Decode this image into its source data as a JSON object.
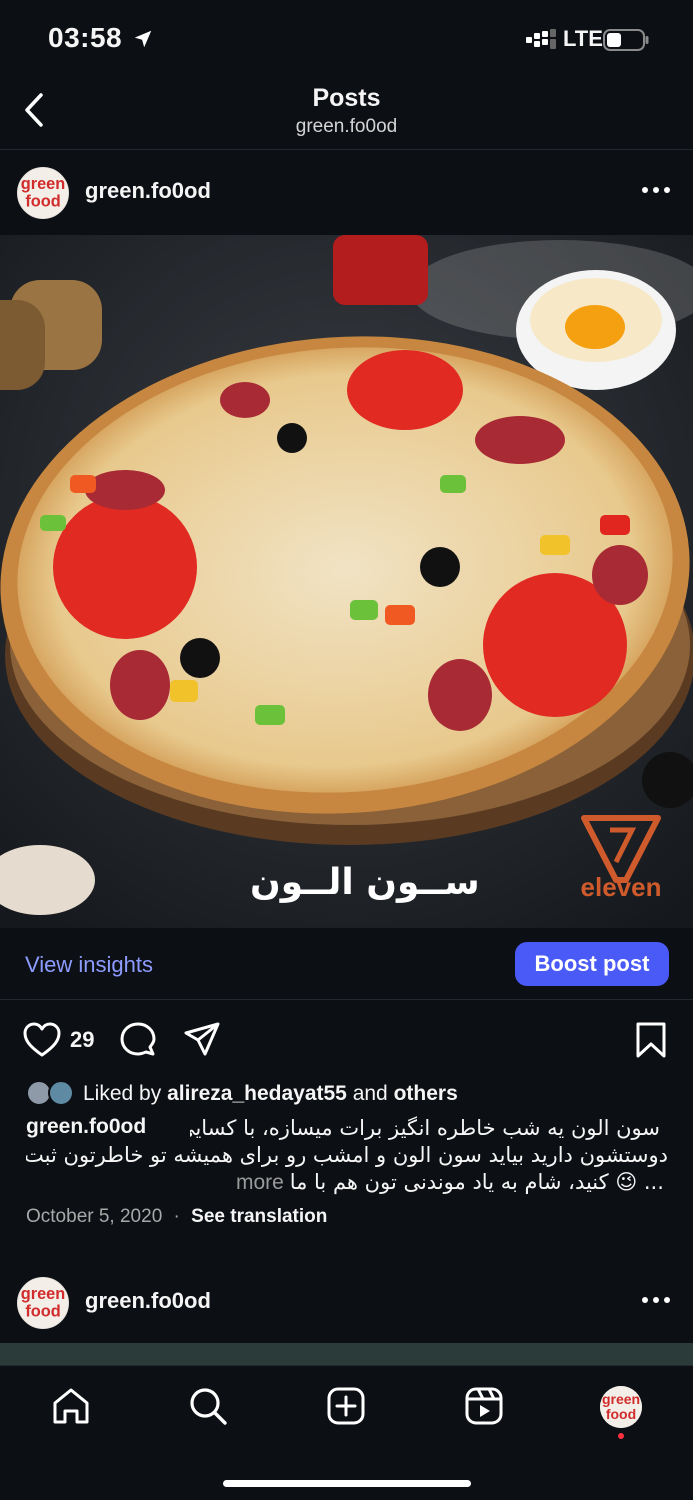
{
  "status_bar": {
    "time": "03:58",
    "network": "LTE"
  },
  "header": {
    "title": "Posts",
    "subtitle": "green.fo0od"
  },
  "post": {
    "username": "green.fo0od",
    "brand_text_persian": "ســون الــون",
    "logo_text": "eleven",
    "insights_label": "View insights",
    "boost_label": "Boost post",
    "like_count": "29",
    "likes": {
      "prefix": "Liked by",
      "user": "alireza_hedayat55",
      "connector": "and",
      "others": "others"
    },
    "caption": {
      "username": "green.fo0od",
      "line1": "سون الون یه شب خاطره انگیز برات میسازه، با کسایی که",
      "line2": "دوستشون دارید بیاید سون الون و امشب رو برای همیشه تو خاطرتون ثبت",
      "line3": "کنید، شام به یاد موندنی تون هم با ما 😉 ...",
      "more_label": "more"
    },
    "date": "October 5, 2020",
    "separator": "·",
    "translation_label": "See translation"
  },
  "next_post": {
    "username": "green.fo0od"
  },
  "avatar_text": [
    "green",
    "food"
  ],
  "colors": {
    "accent_blue": "#4a5af6",
    "insights_blue": "#8d9cff",
    "notification_red": "#ff3040",
    "background": "#0c0f14"
  },
  "icons": [
    "location-arrow-icon",
    "signal-icon",
    "battery-icon",
    "back-chevron-icon",
    "more-dots-icon",
    "heart-icon",
    "comment-icon",
    "share-icon",
    "bookmark-icon",
    "home-icon",
    "search-icon",
    "create-icon",
    "reels-icon"
  ]
}
